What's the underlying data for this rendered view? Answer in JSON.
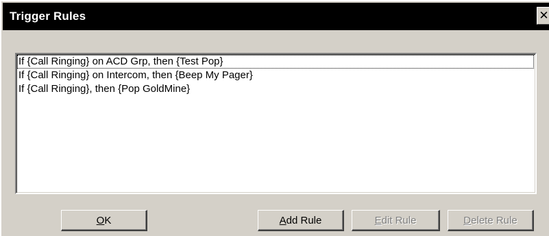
{
  "window": {
    "title": "Trigger Rules",
    "close_glyph": "✕"
  },
  "rules": [
    "If {Call Ringing} on ACD Grp, then {Test Pop}",
    "If {Call Ringing} on Intercom, then {Beep My Pager}",
    "If {Call Ringing}, then {Pop GoldMine}"
  ],
  "buttons": {
    "ok": {
      "acc": "O",
      "rest": "K",
      "enabled": true
    },
    "add_rule": {
      "acc": "A",
      "rest": "dd Rule",
      "enabled": true
    },
    "edit_rule": {
      "acc": "E",
      "rest": "dit Rule",
      "enabled": false
    },
    "delete_rule": {
      "acc": "D",
      "rest": "elete Rule",
      "enabled": false
    }
  },
  "colors": {
    "titlebar": "#000000",
    "face": "#d4d0c8",
    "disabled_text": "#808080"
  }
}
